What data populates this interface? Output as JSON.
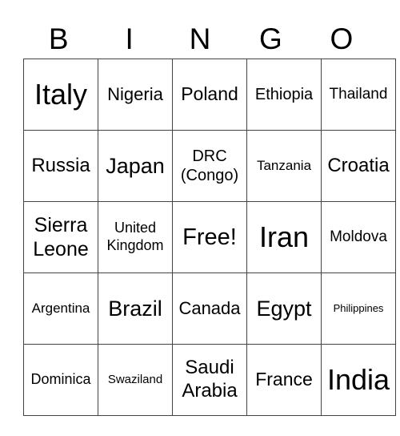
{
  "header": [
    "B",
    "I",
    "N",
    "G",
    "O"
  ],
  "grid": [
    [
      "Italy",
      "Nigeria",
      "Poland",
      "Ethiopia",
      "Thailand"
    ],
    [
      "Russia",
      "Japan",
      "DRC (Congo)",
      "Tanzania",
      "Croatia"
    ],
    [
      "Sierra Leone",
      "United Kingdom",
      "Free!",
      "Iran",
      "Moldova"
    ],
    [
      "Argentina",
      "Brazil",
      "Canada",
      "Egypt",
      "Philippines"
    ],
    [
      "Dominica",
      "Swaziland",
      "Saudi Arabia",
      "France",
      "India"
    ]
  ]
}
